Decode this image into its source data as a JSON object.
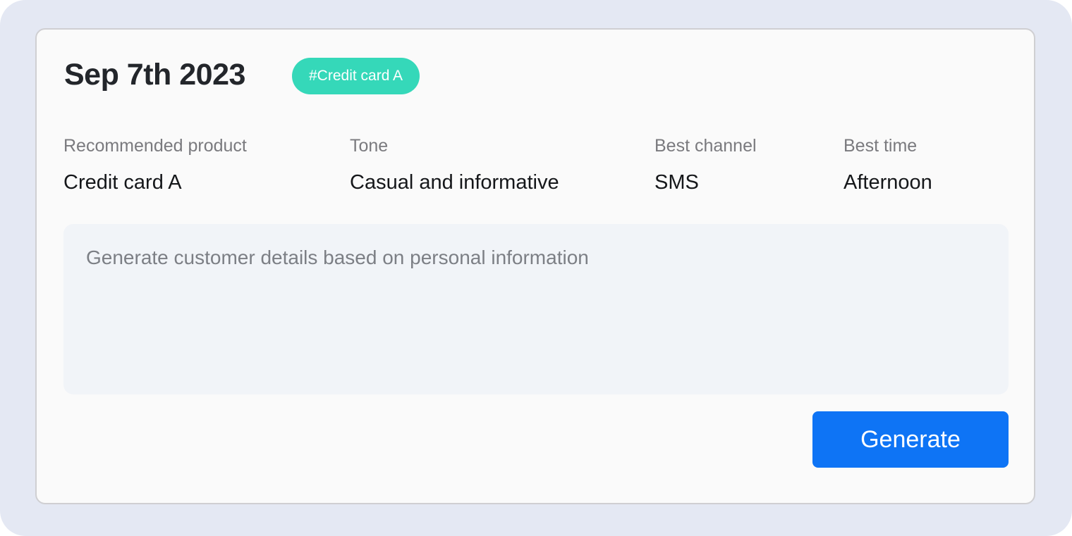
{
  "card": {
    "date": "Sep 7th 2023",
    "tag": "#Credit card A"
  },
  "info": [
    {
      "label": "Recommended product",
      "value": "Credit card A"
    },
    {
      "label": "Tone",
      "value": "Casual and informative"
    },
    {
      "label": "Best channel",
      "value": "SMS"
    },
    {
      "label": "Best time",
      "value": "Afternoon"
    }
  ],
  "prompt": {
    "placeholder": "Generate customer details based on personal information"
  },
  "actions": {
    "generate_label": "Generate"
  },
  "colors": {
    "background": "#e4e8f3",
    "card": "#fafafa",
    "tag": "#35d8b9",
    "primary_button": "#0e74f5",
    "prompt_background": "#f1f4f8"
  }
}
